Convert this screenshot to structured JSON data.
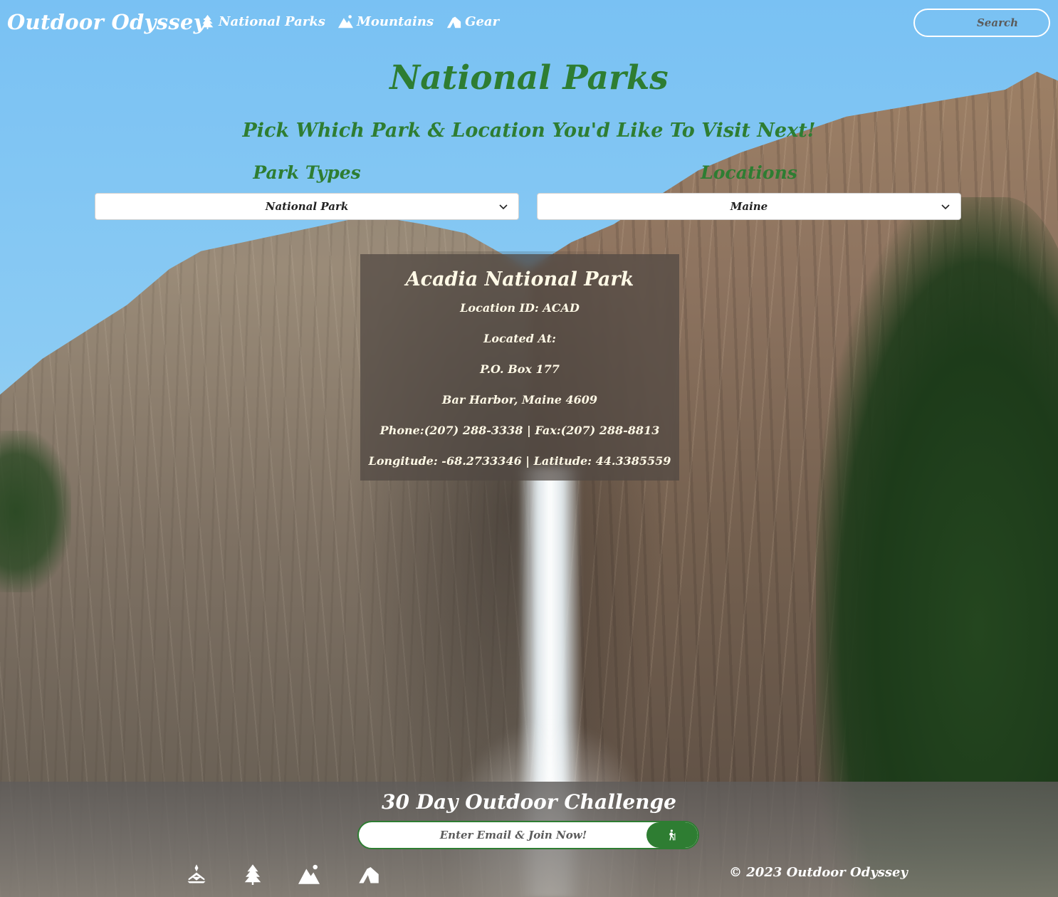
{
  "header": {
    "brand": "Outdoor Odyssey",
    "nav": [
      {
        "label": "National Parks",
        "icon": "tree-icon"
      },
      {
        "label": "Mountains",
        "icon": "mountain-icon"
      },
      {
        "label": "Gear",
        "icon": "tent-icon"
      }
    ],
    "search": {
      "placeholder": "Search",
      "icon": "compass-icon"
    }
  },
  "main": {
    "title": "National Parks",
    "subtitle": "Pick Which Park & Location You'd Like To Visit Next!",
    "filters": [
      {
        "label": "Park Types",
        "selected": "National Park"
      },
      {
        "label": "Locations",
        "selected": "Maine"
      }
    ],
    "park": {
      "name": "Acadia National Park",
      "location_id": "Location ID: ACAD",
      "located_at": "Located At:",
      "address1": "P.O. Box 177",
      "address2": "Bar Harbor, Maine 4609",
      "phone_fax": "Phone:(207) 288-3338 | Fax:(207) 288-8813",
      "coords": "Longitude: -68.2733346 | Latitude: 44.3385559"
    }
  },
  "footer": {
    "challenge_title": "30 Day Outdoor Challenge",
    "email_placeholder": "Enter Email & Join Now!",
    "join_icon": "hiker-icon",
    "icons": [
      "campfire-icon",
      "tree-icon",
      "mountain-icon",
      "tent-icon"
    ],
    "copyright": "© 2023 Outdoor Odyssey"
  },
  "colors": {
    "accent_green": "#2e7d32",
    "sky_blue": "#7fc3ef",
    "card_text": "#fff9e6"
  }
}
